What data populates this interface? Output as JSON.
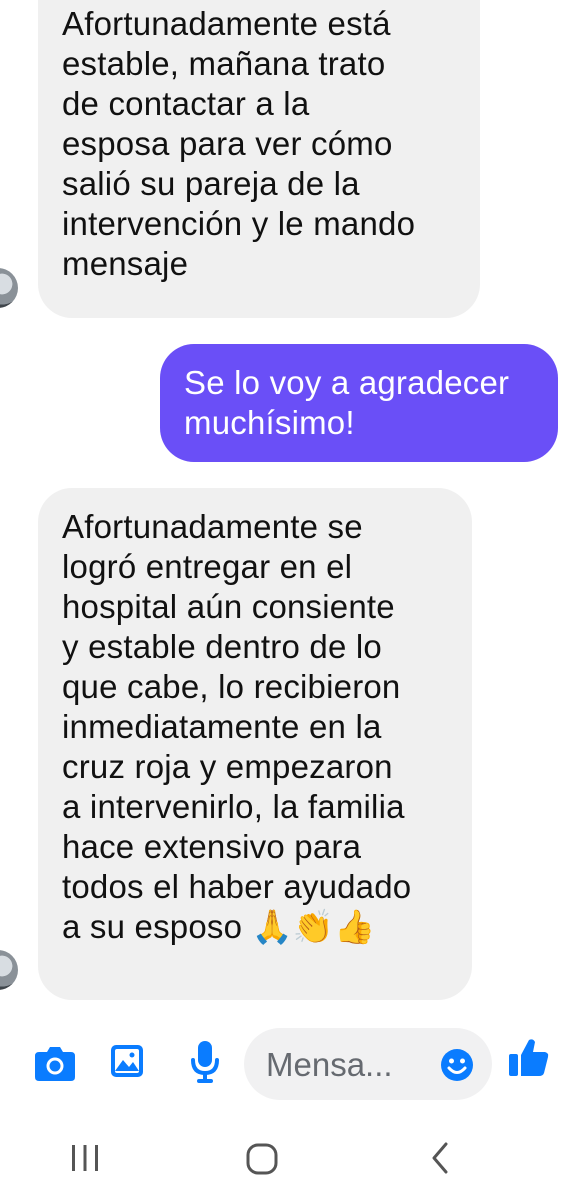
{
  "conversation": {
    "messages": [
      {
        "direction": "incoming",
        "text": "Afortunadamente está\nestable, mañana trato\nde contactar a la\nesposa para ver cómo\nsalió su pareja de la\nintervención y le mando\nmensaje"
      },
      {
        "direction": "outgoing",
        "text": "Se lo voy a agradecer\nmuchísimo!"
      },
      {
        "direction": "incoming",
        "text": "Afortunadamente se\nlogró entregar en el\nhospital aún consiente\ny estable dentro de lo\nque cabe, lo recibieron\ninmediatamente en la\ncruz roja y empezaron\na intervenirlo, la familia\nhace extensivo para\ntodos el haber ayudado\na su esposo 🙏👏👍"
      }
    ]
  },
  "composer": {
    "placeholder": "Mensa...",
    "icons": [
      "camera-icon",
      "image-icon",
      "microphone-icon",
      "emoji-icon",
      "thumbs-up-icon"
    ],
    "accent_color": "#0a7cff"
  },
  "navigation_bar": {
    "icons": [
      "recent-apps-icon",
      "home-icon",
      "back-icon"
    ]
  },
  "colors": {
    "incoming_bubble": "#f0f0f0",
    "outgoing_bubble": "#6a4ff7",
    "icon_blue": "#0a7cff"
  }
}
